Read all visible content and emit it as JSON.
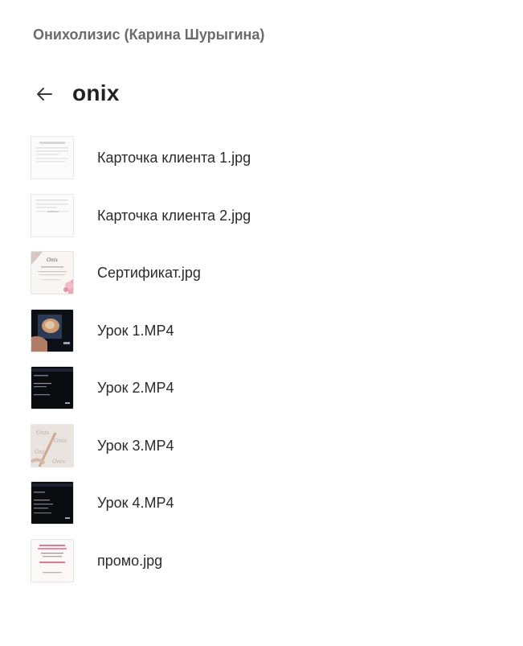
{
  "header": {
    "breadcrumb": "Онихолизис (Карина Шурыгина)",
    "back_icon": "arrow-left-icon",
    "folder_title": "onix"
  },
  "files": [
    {
      "name": "Карточка клиента 1.jpg",
      "thumb": "document-form"
    },
    {
      "name": "Карточка клиента 2.jpg",
      "thumb": "document-form"
    },
    {
      "name": "Сертификат.jpg",
      "thumb": "certificate"
    },
    {
      "name": "Урок 1.MP4",
      "thumb": "video-nail-closeup"
    },
    {
      "name": "Урок 2.MP4",
      "thumb": "video-dark-slide"
    },
    {
      "name": "Урок 3.MP4",
      "thumb": "video-light-pattern"
    },
    {
      "name": "Урок 4.MP4",
      "thumb": "video-dark-slide"
    },
    {
      "name": "промо.jpg",
      "thumb": "promo-card"
    }
  ],
  "colors": {
    "breadcrumb": "#6b6b6b",
    "title": "#222222",
    "text": "#2b2b2b",
    "thumb_border": "#e4e4e4"
  }
}
